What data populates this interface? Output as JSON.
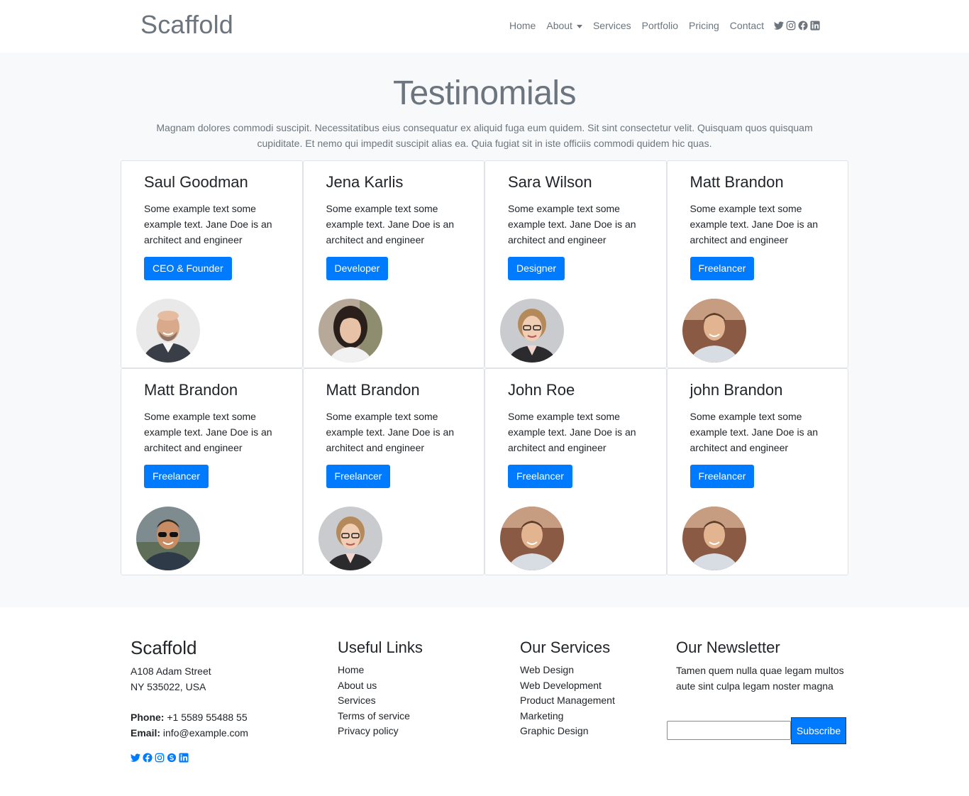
{
  "navbar": {
    "brand": "Scaffold",
    "links": [
      "Home",
      "About",
      "Services",
      "Portfolio",
      "Pricing",
      "Contact"
    ],
    "social_icons": [
      "twitter-icon",
      "instagram-icon",
      "facebook-icon",
      "linkedin-icon"
    ]
  },
  "testimonials": {
    "title": "Testinomials",
    "description": "Magnam dolores commodi suscipit. Necessitatibus eius consequatur ex aliquid fuga eum quidem. Sit sint consectetur velit. Quisquam quos quisquam cupiditate. Et nemo qui impedit suscipit alias ea. Quia fugiat sit in iste officiis commodi quidem hic quas.",
    "cards": [
      {
        "name": "Saul Goodman",
        "text": "Some example text some example text. Jane Doe is an architect and engineer",
        "role": "CEO & Founder"
      },
      {
        "name": "Jena Karlis",
        "text": "Some example text some example text. Jane Doe is an architect and engineer",
        "role": "Developer"
      },
      {
        "name": "Sara Wilson",
        "text": "Some example text some example text. Jane Doe is an architect and engineer",
        "role": "Designer"
      },
      {
        "name": "Matt Brandon",
        "text": "Some example text some example text. Jane Doe is an architect and engineer",
        "role": "Freelancer"
      },
      {
        "name": "Matt Brandon",
        "text": "Some example text some example text. Jane Doe is an architect and engineer",
        "role": "Freelancer"
      },
      {
        "name": "Matt Brandon",
        "text": "Some example text some example text. Jane Doe is an architect and engineer",
        "role": "Freelancer"
      },
      {
        "name": "John Roe",
        "text": "Some example text some example text. Jane Doe is an architect and engineer",
        "role": "Freelancer"
      },
      {
        "name": "john Brandon",
        "text": "Some example text some example text. Jane Doe is an architect and engineer",
        "role": "Freelancer"
      }
    ]
  },
  "footer": {
    "brand": "Scaffold",
    "address_line1": "A108 Adam Street",
    "address_line2": "NY 535022, USA",
    "phone_label": "Phone:",
    "phone": "+1 5589 55488 55",
    "email_label": "Email:",
    "email": "info@example.com",
    "social_icons": [
      "twitter-icon",
      "facebook-icon",
      "instagram-icon",
      "skype-icon",
      "linkedin-icon"
    ],
    "useful_links": {
      "heading": "Useful Links",
      "items": [
        "Home",
        "About us",
        "Services",
        "Terms of service",
        "Privacy policy"
      ]
    },
    "services": {
      "heading": "Our Services",
      "items": [
        "Web Design",
        "Web Development",
        "Product Management",
        "Marketing",
        "Graphic Design"
      ]
    },
    "newsletter": {
      "heading": "Our Newsletter",
      "text": "Tamen quem nulla quae legam multos aute sint culpa legam noster magna",
      "input_value": "",
      "button_label": "Subscribe"
    }
  },
  "colors": {
    "primary": "#007bff",
    "muted": "#6c757d",
    "section_bg": "#f8f9fa",
    "text": "#212529"
  }
}
